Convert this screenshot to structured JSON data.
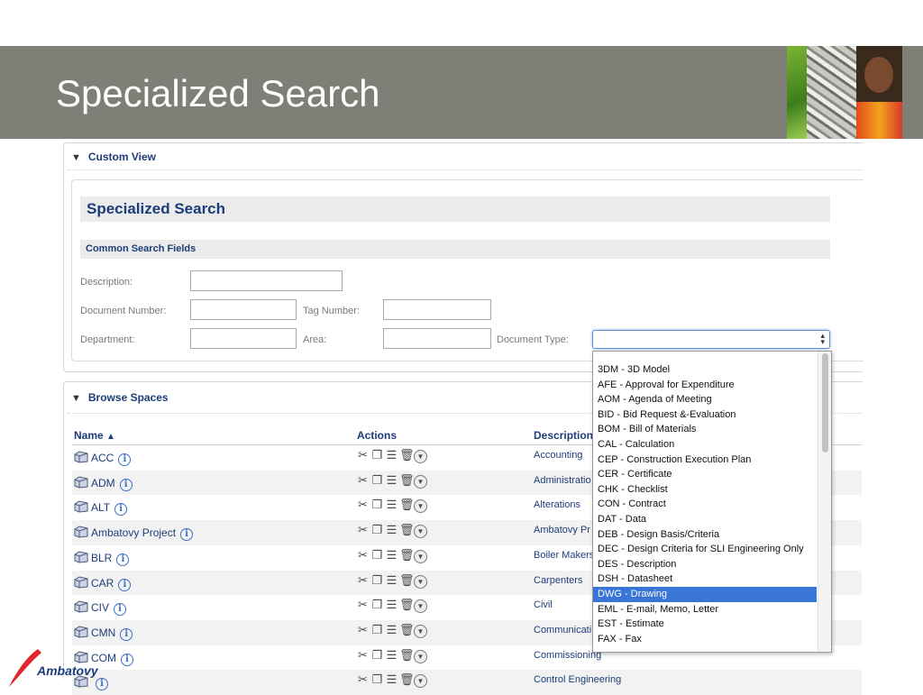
{
  "slide": {
    "title": "Specialized Search"
  },
  "custom_view": {
    "label": "Custom View"
  },
  "form": {
    "heading": "Specialized Search",
    "section": "Common Search Fields",
    "labels": {
      "description": "Description:",
      "document_number": "Document Number:",
      "tag_number": "Tag Number:",
      "department": "Department:",
      "area": "Area:",
      "document_type": "Document Type:"
    },
    "values": {
      "description": "",
      "document_number": "",
      "tag_number": "",
      "department": "",
      "area": "",
      "document_type": ""
    }
  },
  "dropdown": {
    "options": [
      "3DM - 3D Model",
      "AFE - Approval for Expenditure",
      "AOM - Agenda of Meeting",
      "BID - Bid Request &-Evaluation",
      "BOM - Bill of Materials",
      "CAL - Calculation",
      "CEP - Construction Execution Plan",
      "CER - Certificate",
      "CHK - Checklist",
      "CON - Contract",
      "DAT - Data",
      "DEB - Design Basis/Criteria",
      "DEC - Design Criteria for SLI Engineering Only",
      "DES - Description",
      "DSH - Datasheet",
      "DWG - Drawing",
      "EML - E-mail, Memo, Letter",
      "EST - Estimate",
      "FAX - Fax"
    ],
    "highlighted": "DWG - Drawing"
  },
  "browse": {
    "label": "Browse Spaces",
    "columns": {
      "name": "Name",
      "actions": "Actions",
      "description": "Description"
    },
    "sort_indicator": "▲",
    "rows": [
      {
        "name": "ACC",
        "description": "Accounting"
      },
      {
        "name": "ADM",
        "description": "Administratio"
      },
      {
        "name": "ALT",
        "description": "Alterations"
      },
      {
        "name": "Ambatovy Project",
        "description": "Ambatovy Pr"
      },
      {
        "name": "BLR",
        "description": "Boiler Makers"
      },
      {
        "name": "CAR",
        "description": "Carpenters"
      },
      {
        "name": "CIV",
        "description": "Civil"
      },
      {
        "name": "CMN",
        "description": "Communicati"
      },
      {
        "name": "COM",
        "description": "Commissioning"
      },
      {
        "name": "",
        "description": "Control Engineering"
      }
    ]
  },
  "brand": {
    "logo_text": "Ambatovy",
    "accent": "#1d3d7a",
    "logo_red": "#e3262d"
  }
}
